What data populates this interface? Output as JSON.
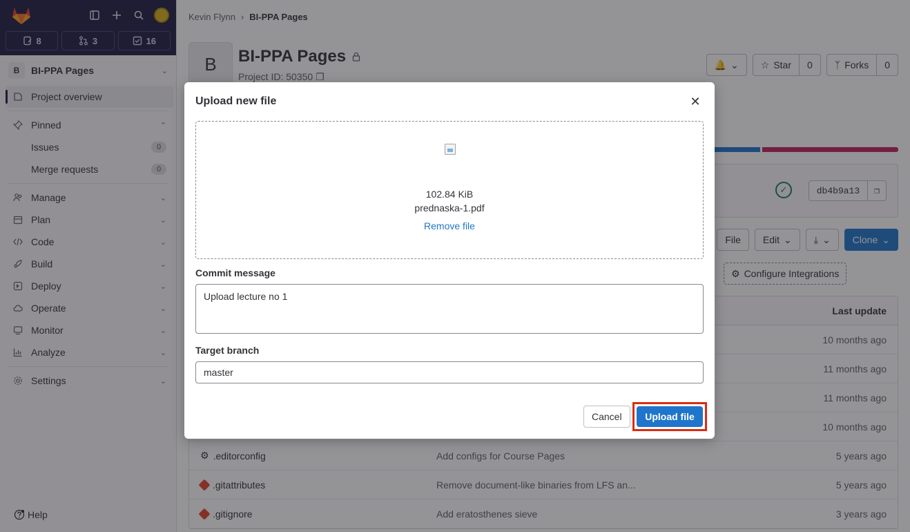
{
  "sidebar": {
    "counts": {
      "issues": "8",
      "merge_requests": "3",
      "todos": "16"
    },
    "project": {
      "initial": "B",
      "name": "BI-PPA Pages"
    },
    "nav": {
      "overview": "Project overview",
      "pinned": "Pinned",
      "issues": "Issues",
      "issues_count": "0",
      "merge_requests": "Merge requests",
      "merge_requests_count": "0",
      "manage": "Manage",
      "plan": "Plan",
      "code": "Code",
      "build": "Build",
      "deploy": "Deploy",
      "operate": "Operate",
      "monitor": "Monitor",
      "analyze": "Analyze",
      "settings": "Settings"
    },
    "help": "Help"
  },
  "breadcrumb": {
    "user": "Kevin Flynn",
    "project": "BI-PPA Pages"
  },
  "project": {
    "avatar_initial": "B",
    "title": "BI-PPA Pages",
    "id_text": "Project ID: 50350",
    "star_label": "Star",
    "star_count": "0",
    "forks_label": "Forks",
    "forks_count": "0"
  },
  "commit": {
    "sha": "db4b9a13"
  },
  "actions": {
    "file_label": "File",
    "edit_label": "Edit",
    "clone_label": "Clone",
    "configure_integrations": "Configure Integrations"
  },
  "table": {
    "last_update_header": "Last update",
    "rows": [
      {
        "name": "",
        "message": "",
        "when": "10 months ago"
      },
      {
        "name": "",
        "message": "",
        "when": "11 months ago"
      },
      {
        "name": "",
        "message": "",
        "when": "11 months ago"
      },
      {
        "name": "",
        "message": "",
        "when": "10 months ago"
      },
      {
        "name": ".editorconfig",
        "message": "Add configs for Course Pages",
        "when": "5 years ago"
      },
      {
        "name": ".gitattributes",
        "message": "Remove document-like binaries from LFS an...",
        "when": "5 years ago"
      },
      {
        "name": ".gitignore",
        "message": "Add eratosthenes sieve",
        "when": "3 years ago"
      }
    ]
  },
  "modal": {
    "title": "Upload new file",
    "file_size": "102.84 KiB",
    "file_name": "prednaska-1.pdf",
    "remove_label": "Remove file",
    "commit_label": "Commit message",
    "commit_value": "Upload lecture no 1",
    "branch_label": "Target branch",
    "branch_value": "master",
    "cancel_label": "Cancel",
    "upload_label": "Upload file"
  },
  "colors": {
    "primary": "#1f75cb",
    "sidebar_top": "#1f1e42",
    "highlight_outline": "#dd2b0e",
    "success": "#108548"
  }
}
